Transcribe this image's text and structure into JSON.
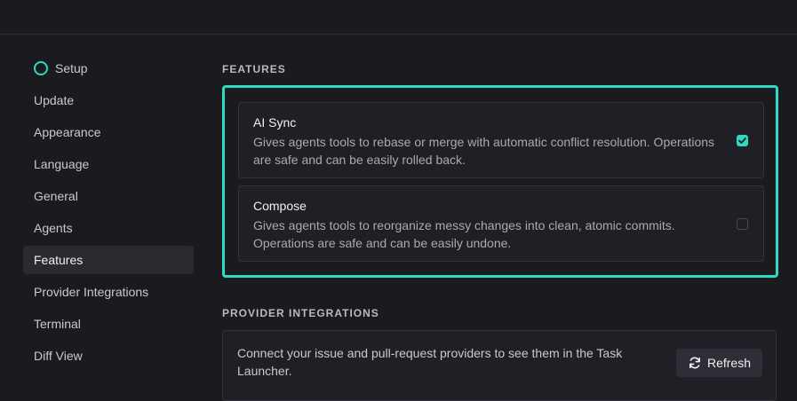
{
  "sidebar": {
    "items": [
      {
        "label": "Setup"
      },
      {
        "label": "Update"
      },
      {
        "label": "Appearance"
      },
      {
        "label": "Language"
      },
      {
        "label": "General"
      },
      {
        "label": "Agents"
      },
      {
        "label": "Features"
      },
      {
        "label": "Provider Integrations"
      },
      {
        "label": "Terminal"
      },
      {
        "label": "Diff View"
      }
    ],
    "active": "Features"
  },
  "features": {
    "heading": "FEATURES",
    "cards": [
      {
        "title": "AI Sync",
        "description": "Gives agents tools to rebase or merge with automatic conflict resolution. Operations are safe and can be easily rolled back.",
        "checked": true
      },
      {
        "title": "Compose",
        "description": "Gives agents tools to reorganize messy changes into clean, atomic commits. Operations are safe and can be easily undone.",
        "checked": false
      }
    ]
  },
  "provider_integrations": {
    "heading": "PROVIDER INTEGRATIONS",
    "description": "Connect your issue and pull-request providers to see them in the Task Launcher.",
    "refresh_label": "Refresh"
  },
  "colors": {
    "accent": "#2fd9c4",
    "background": "#1a1b1f",
    "card": "#1f2025"
  }
}
